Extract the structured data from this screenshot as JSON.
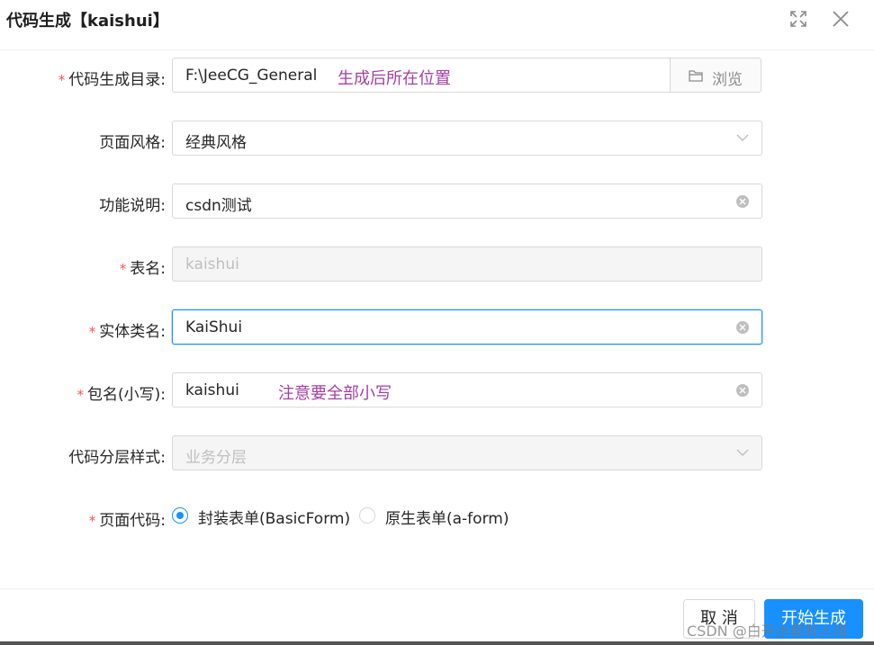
{
  "modal": {
    "title": "代码生成【kaishui】"
  },
  "form": {
    "output_dir": {
      "label": "代码生成目录:",
      "value": "F:\\JeeCG_General",
      "note": "生成后所在位置",
      "browse_label": "浏览"
    },
    "page_style": {
      "label": "页面风格:",
      "value": "经典风格"
    },
    "description": {
      "label": "功能说明:",
      "value": "csdn测试"
    },
    "table_name": {
      "label": "表名:",
      "value": "kaishui"
    },
    "entity_name": {
      "label": "实体类名:",
      "value": "KaiShui"
    },
    "package_name": {
      "label": "包名(小写):",
      "value": "kaishui",
      "note": "注意要全部小写"
    },
    "layer_style": {
      "label": "代码分层样式:",
      "value": "业务分层"
    },
    "page_code": {
      "label": "页面代码:",
      "options": [
        "封装表单(BasicForm)",
        "原生表单(a-form)"
      ],
      "selected": "封装表单(BasicForm)"
    }
  },
  "footer": {
    "cancel_label": "取 消",
    "submit_label": "开始生成"
  },
  "watermark": "CSDN @白开水都有人用",
  "colors": {
    "accent": "#1890ff",
    "required": "#ff4d4f",
    "annotation": "#a43fa4"
  }
}
